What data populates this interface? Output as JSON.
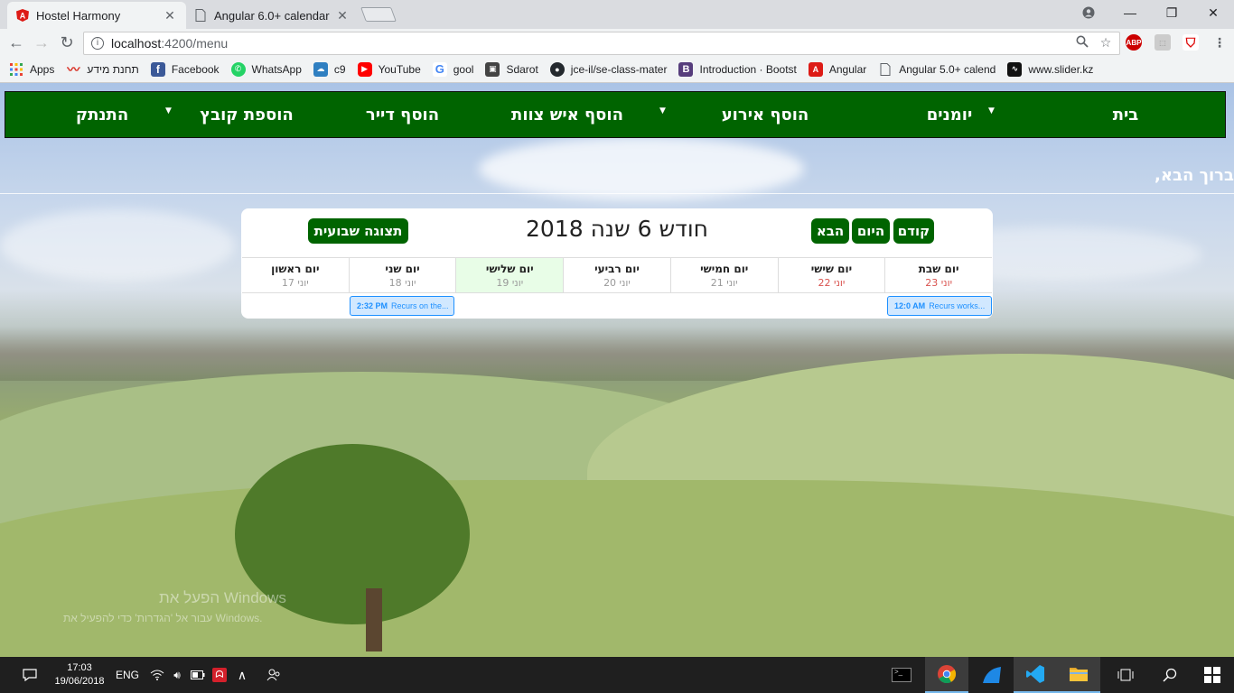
{
  "browser": {
    "tabs": [
      {
        "title": "Hostel Harmony",
        "active": true,
        "icon": "angular-icon"
      },
      {
        "title": "Angular 6.0+ calendar",
        "active": false,
        "icon": "page-icon"
      }
    ],
    "url_host": "localhost",
    "url_path": ":4200/menu",
    "bookmarks": [
      {
        "label": "Apps",
        "icon": "apps-grid-icon",
        "color": "#5f6368"
      },
      {
        "label": "תחנת מידע",
        "icon": "bookmark-icon",
        "color": "#d93025"
      },
      {
        "label": "Facebook",
        "icon": "facebook-icon",
        "color": "#3b5998"
      },
      {
        "label": "WhatsApp",
        "icon": "whatsapp-icon",
        "color": "#25d366"
      },
      {
        "label": "c9",
        "icon": "cloud9-icon",
        "color": "#2f7fc1"
      },
      {
        "label": "YouTube",
        "icon": "youtube-icon",
        "color": "#ff0000"
      },
      {
        "label": "gool",
        "icon": "google-icon",
        "color": "#4285f4"
      },
      {
        "label": "Sdarot",
        "icon": "tv-icon",
        "color": "#444"
      },
      {
        "label": "jce-il/se-class-mater",
        "icon": "github-icon",
        "color": "#24292e"
      },
      {
        "label": "Introduction · Bootst",
        "icon": "bootstrap-icon",
        "color": "#563d7c"
      },
      {
        "label": "Angular",
        "icon": "angular-icon",
        "color": "#dd1b16"
      },
      {
        "label": "Angular 5.0+ calend",
        "icon": "page-icon",
        "color": "#9aa0a6"
      },
      {
        "label": "www.slider.kz",
        "icon": "waveform-icon",
        "color": "#111"
      }
    ]
  },
  "nav": {
    "items": [
      {
        "label": "בית",
        "dropdown": false
      },
      {
        "label": "יומנים",
        "dropdown": true
      },
      {
        "label": "הוסף אירוע",
        "dropdown": true
      },
      {
        "label": "הוסף איש צוות",
        "dropdown": false
      },
      {
        "label": "הוסף דייר",
        "dropdown": false
      },
      {
        "label": "הוספת קובץ",
        "dropdown": true
      },
      {
        "label": "התנתק",
        "dropdown": false
      }
    ],
    "bg_color": "#006400"
  },
  "welcome": "ברוך הבא,",
  "calendar": {
    "prev": "קודם",
    "today": "היום",
    "next": "הבא",
    "title": "חודש 6 שנה 2018",
    "week_view": "תצוגה שבועית",
    "days": [
      {
        "name": "יום שבת",
        "date": "יוני 23",
        "weekend": true
      },
      {
        "name": "יום שישי",
        "date": "יוני 22",
        "weekend": true
      },
      {
        "name": "יום חמישי",
        "date": "יוני 21"
      },
      {
        "name": "יום רביעי",
        "date": "יוני 20"
      },
      {
        "name": "יום שלישי",
        "date": "יוני 19",
        "today": true
      },
      {
        "name": "יום שני",
        "date": "יוני 18"
      },
      {
        "name": "יום ראשון",
        "date": "יוני 17"
      }
    ],
    "events": [
      {
        "time": "2:32 PM",
        "text": "Recurs on the..."
      },
      {
        "time": "12:0 AM",
        "text": "Recurs works..."
      }
    ]
  },
  "watermark": {
    "line1": "הפעל את Windows",
    "line2": "עבור אל 'הגדרות' כדי להפעיל את Windows."
  },
  "taskbar": {
    "time": "17:03",
    "date": "19/06/2018",
    "lang": "ENG"
  }
}
